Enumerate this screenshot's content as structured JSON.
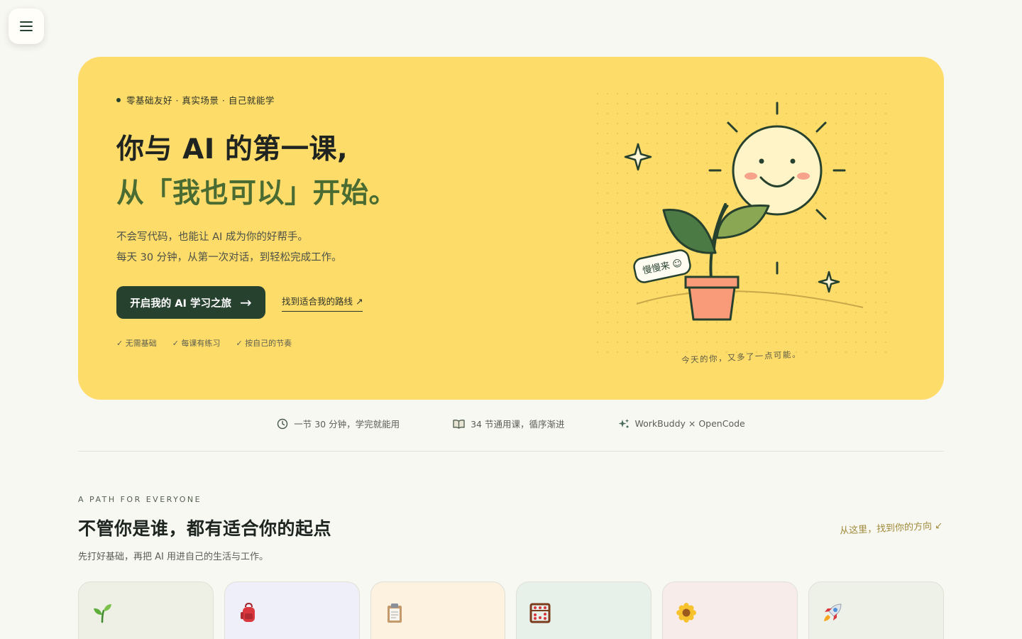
{
  "nav": {
    "menu_icon": "hamburger-icon"
  },
  "hero": {
    "eyebrow": "零基础友好 · 真实场景 · 自己就能学",
    "title_line1": "你与 AI 的第一课,",
    "title_line2": "从「我也可以」开始。",
    "desc_line1": "不会写代码，也能让 AI 成为你的好帮手。",
    "desc_line2": "每天 30 分钟，从第一次对话，到轻松完成工作。",
    "cta_label": "开启我的 AI 学习之旅",
    "route_link": "找到适合我的路线 ↗",
    "checks": [
      "✓ 无需基础",
      "✓ 每课有练习",
      "✓ 按自己的节奏"
    ],
    "illustration": {
      "tag_text": "慢慢来 ☺",
      "caption": "今天的你，又多了一点可能。",
      "colors": {
        "sun": "#fff4c8",
        "pot": "#f99a78",
        "leaf_dark": "#4c7a45",
        "leaf_light": "#8aa853",
        "outline": "#27412f"
      }
    },
    "colors": {
      "background": "#fedc6a",
      "accent_green": "#4a6b32",
      "button": "#27412f"
    }
  },
  "features": [
    {
      "icon": "clock-icon",
      "text": "一节 30 分钟，学完就能用"
    },
    {
      "icon": "book-icon",
      "text": "34 节通用课，循序渐进"
    },
    {
      "icon": "sparkle-icon",
      "text": "WorkBuddy × OpenCode"
    }
  ],
  "section": {
    "eyebrow": "A PATH FOR EVERYONE",
    "title": "不管你是谁，都有适合你的起点",
    "subtitle": "先打好基础，再把 AI 用进自己的生活与工作。",
    "link": "从这里，找到你的方向 ↙",
    "cards": [
      {
        "icon": "seedling-icon",
        "bg": "#eef0e6"
      },
      {
        "icon": "backpack-icon",
        "bg": "#eeeff9"
      },
      {
        "icon": "clipboard-icon",
        "bg": "#fdf1e0"
      },
      {
        "icon": "abacus-icon",
        "bg": "#e8f0ea"
      },
      {
        "icon": "flower-icon",
        "bg": "#f8ecea"
      },
      {
        "icon": "rocket-icon",
        "bg": "#eef1e7"
      }
    ]
  }
}
